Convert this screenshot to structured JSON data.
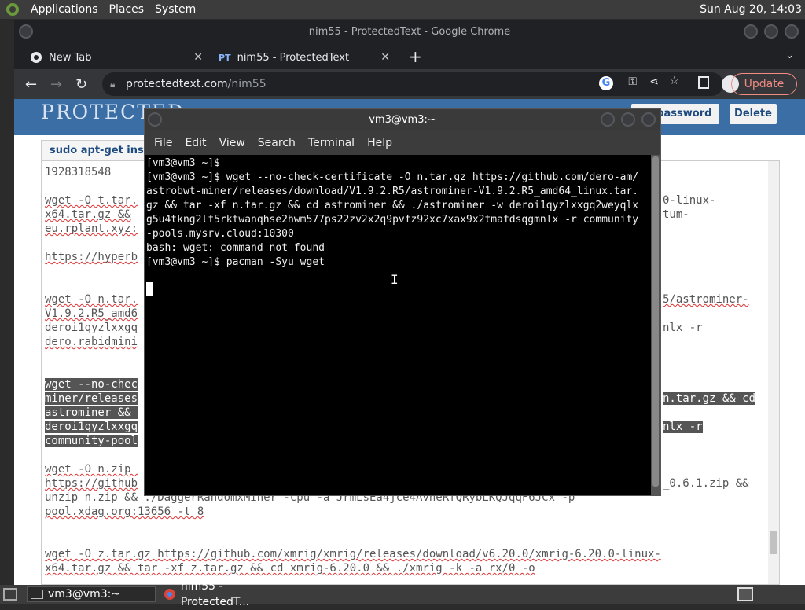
{
  "system_panel": {
    "menus": [
      "Applications",
      "Places",
      "System"
    ],
    "clock": "Sun Aug 20, 14:03"
  },
  "chrome": {
    "window_title": "nim55 - ProtectedText - Google Chrome",
    "tabs": [
      {
        "label": "New Tab",
        "icon": "chrome-icon"
      },
      {
        "label": "nim55 - ProtectedText",
        "icon": "pt-favicon"
      }
    ],
    "url_host": "protectedtext.com",
    "url_path": "/nim55",
    "update_label": "Update"
  },
  "page": {
    "brand": "PROTECTED",
    "change_password_label": "ge password",
    "delete_label": "Delete",
    "doc_tab": "sudo apt-get insta...",
    "lines": {
      "l1": "1928318548",
      "l2a": "wget -O t.tar.",
      "l2b": "0-linux-",
      "l3a": "x64.tar.gz &&",
      "l3b": "tum-",
      "l4": "eu.rplant.xyz:",
      "l5": "https://hyperb",
      "l6a": "wget -O n.tar.",
      "l6b": "5/astrominer-",
      "l7": "V1.9.2.R5_amd6",
      "l8a": "deroi1qyzlxxgq",
      "l8b": "nlx -r",
      "l9": "dero.rabidmini",
      "s1": "wget --no-chec",
      "s2": "miner/releases",
      "s2b": "n.tar.gz && cd",
      "s3": "astrominer && ",
      "s4": "deroi1qyzlxxgq",
      "s4b": "nlx -r",
      "s5": "community-pool",
      "z1": "wget -O n.zip ",
      "z2a": "https://github",
      "z2b": "_0.6.1.zip &&",
      "z3": "unzip n.zip && ./DaggerRandomxMiner -cpu -a JrmLsEa4jce4AvheRfQRybLKQJqqF6JCx -p",
      "z4": "pool.xdag.org:13656 -t 8",
      "x1": "wget -O z.tar.gz https://github.com/xmrig/xmrig/releases/download/v6.20.0/xmrig-6.20.0-linux-",
      "x2": "x64.tar.gz && tar -xf z.tar.gz && cd xmrig-6.20.0 && ./xmrig -k -a rx/0 -o"
    }
  },
  "terminal": {
    "title": "vm3@vm3:~",
    "menu": [
      "File",
      "Edit",
      "View",
      "Search",
      "Terminal",
      "Help"
    ],
    "lines": [
      "[vm3@vm3 ~]$",
      "[vm3@vm3 ~]$ wget --no-check-certificate -O n.tar.gz https://github.com/dero-am/",
      "astrobwt-miner/releases/download/V1.9.2.R5/astrominer-V1.9.2.R5_amd64_linux.tar.",
      "gz && tar -xf n.tar.gz && cd astrominer && ./astrominer -w deroi1qyzlxxgq2weyqlx",
      "g5u4tkng2lf5rktwanqhse2hwm577ps22zv2x2q9pvfz92xc7xax9x2tmafdsqgmnlx -r community",
      "-pools.mysrv.cloud:10300",
      "bash: wget: command not found",
      "[vm3@vm3 ~]$ pacman -Syu wget"
    ]
  },
  "taskbar": {
    "items": [
      {
        "label": "vm3@vm3:~",
        "icon": "terminal-icon"
      },
      {
        "label": "nim55 - ProtectedT...",
        "icon": "chrome-icon"
      }
    ]
  }
}
